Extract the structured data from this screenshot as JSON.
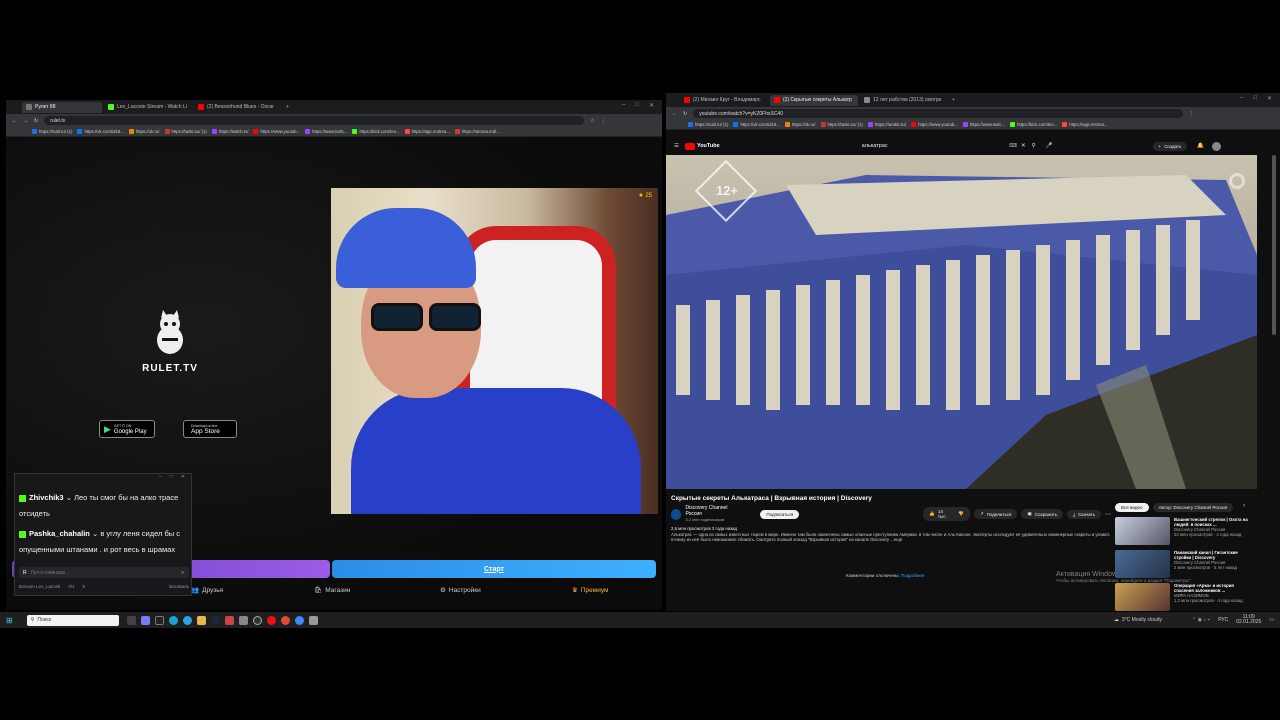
{
  "left_browser": {
    "tabs": [
      {
        "label": "Рулет 88",
        "active": true
      },
      {
        "label": "Leo_Lacoste Stream - Watch Li",
        "active": false
      },
      {
        "label": "(2) Bessonhund Blues - Oscar",
        "active": false
      }
    ],
    "url": "rulet.tv",
    "bookmarks": [
      "https://mail.ru/ (1)",
      "https://vk.com/id18...",
      "https://ok.ru/",
      "https://tanki.su/ (1)",
      "https://twitch.tv/",
      "https://www.youtub...",
      "https://www.twitc...",
      "https://kick.com/leo...",
      "https://app.restrea...",
      "https://stmrea.md/..."
    ]
  },
  "rulet": {
    "logo_text": "RULET.TV",
    "google_play_small": "GET IT ON",
    "google_play": "Google Play",
    "app_store_small": "Download on the",
    "app_store": "App Store",
    "viewer_count": "25",
    "start_button": "Старт",
    "nav": {
      "friends": "Друзья",
      "shop": "Магазин",
      "settings": "Настройки",
      "premium": "Премиум"
    }
  },
  "chat": {
    "messages": [
      {
        "user": "Zhivchik3",
        "text": "Лео ты смог бы на алко трасе отсидеть"
      },
      {
        "user": "Pashka_chahalin",
        "text": "в углу леня сидел бы с опущенными штанами . и рот весь в шрамах"
      }
    ],
    "input_placeholder": "Луч к главнаде...",
    "footer_channel": "Boroom Leo_Lacosti",
    "footer_count": "0/1",
    "footer_count2": "5",
    "footer_button": "Восхваль"
  },
  "right_browser": {
    "tabs": [
      {
        "label": "(2) Михаил Круг - Владимирс",
        "active": false
      },
      {
        "label": "(2) Скрытые секреты Алькатр",
        "active": true
      },
      {
        "label": "12 лет рабства (2013) смотре",
        "active": false
      }
    ],
    "url": "youtube.com/watch?v=yKZ0FhsSC40",
    "bookmarks": [
      "https://mail.ru/ (1)",
      "https://vk.com/id18...",
      "https://ok.ru/",
      "https://tanki.su/ (1)",
      "https://lurakk.su/",
      "https://www.youtub...",
      "https://www.twitc...",
      "https://kick.com/leo...",
      "https://app.restrea..."
    ]
  },
  "youtube": {
    "logo": "YouTube",
    "search_value": "алькатрас",
    "create_label": "Создать",
    "age_badge": "12+",
    "video_title": "Скрытые секреты Алькатраса | Взрывная история | Discovery",
    "channel_name": "Discovery Channel Россия",
    "subscribers": "3,2 млн подписчиков",
    "subscribe": "Подписаться",
    "likes": "14 тыс.",
    "share": "Поделиться",
    "save": "Сохранить",
    "download": "Скачать",
    "views_date": "2,6 млн просмотров  3 года назад",
    "description": "Алькатрас — одна из самых известных тюрем в мире. Именно там были заключены самые опасные преступники Америки, в том числе и Аль Капоне. Эксперты исследуют её удивительно инженерные секреты и узнают, почему из неё было невозможно сбежать. Смотрите полный эпизод \"Взрывная история\" на канале Discovery ...ещё",
    "comments_off": "Комментарии отключены.",
    "comments_link": "Подробнее",
    "filter_all": "Все видео",
    "filter_author": "Автор: Discovery Channel Россия",
    "watermark": "Активация Windows",
    "watermark_sub": "Чтобы активировать Windows, перейдите в раздел \"Параметры\".",
    "related": [
      {
        "title": "Вашингтонский стрелок | Охота на людей: в поисках ...",
        "channel": "Discovery Channel Россия",
        "meta": "23 млн просмотров · 4 года назад",
        "duration": "44:28"
      },
      {
        "title": "Панамский канал | Гигантские стройки | Discovery",
        "channel": "Discovery Channel Россия",
        "meta": "2 млн просмотров · 5 лет назад",
        "duration": "44:14"
      },
      {
        "title": "Операция «Арка» и история спасения заложников ...",
        "channel": "МИРА НАЗИМОВ",
        "meta": "1,2 млн просмотров · 4 года назад",
        "duration": "1:41:30"
      }
    ]
  },
  "taskbar": {
    "search_placeholder": "Поиск",
    "weather": "3°C  Mostly cloudy",
    "lang": "РУС",
    "time": "11:09",
    "date": "02.01.2025"
  }
}
